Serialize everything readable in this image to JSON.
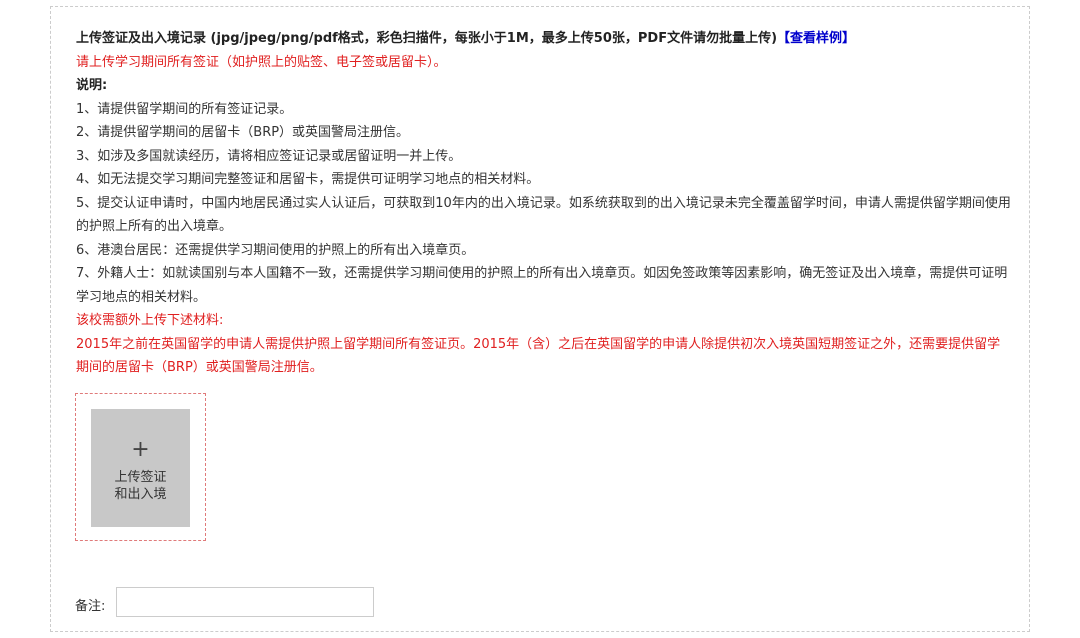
{
  "header": {
    "title": "上传签证及出入境记录 (jpg/jpeg/png/pdf格式，彩色扫描件，每张小于1M，最多上传50张，PDF文件请勿批量上传)",
    "sample_link": "【查看样例】"
  },
  "notice": "请上传学习期间所有签证（如护照上的贴签、电子签或居留卡）。",
  "instructions": {
    "heading": "说明:",
    "items": [
      "1、请提供留学期间的所有签证记录。",
      "2、请提供留学期间的居留卡（BRP）或英国警局注册信。",
      "3、如涉及多国就读经历，请将相应签证记录或居留证明一并上传。",
      "4、如无法提交学习期间完整签证和居留卡，需提供可证明学习地点的相关材料。",
      "5、提交认证申请时，中国内地居民通过实人认证后，可获取到10年内的出入境记录。如系统获取到的出入境记录未完全覆盖留学时间，申请人需提供留学期间使用的护照上所有的出入境章。",
      "6、港澳台居民：还需提供学习期间使用的护照上的所有出入境章页。",
      "7、外籍人士：如就读国别与本人国籍不一致，还需提供学习期间使用的护照上的所有出入境章页。如因免签政策等因素影响，确无签证及出入境章，需提供可证明学习地点的相关材料。"
    ]
  },
  "extra": {
    "heading": "该校需额外上传下述材料:",
    "text": "2015年之前在英国留学的申请人需提供护照上留学期间所有签证页。2015年（含）之后在英国留学的申请人除提供初次入境英国短期签证之外，还需要提供留学期间的居留卡（BRP）或英国警局注册信。"
  },
  "upload": {
    "icon": "plus-icon",
    "label": "上传签证和出入境"
  },
  "remark": {
    "label": "备注:",
    "value": "",
    "placeholder": ""
  }
}
